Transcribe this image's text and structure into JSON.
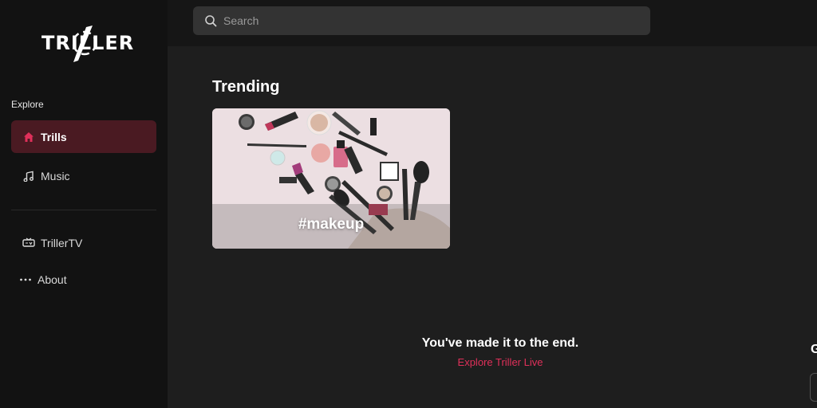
{
  "app": {
    "logo_text": "TRILLER"
  },
  "sidebar": {
    "section_label": "Explore",
    "items": [
      {
        "label": "Trills",
        "icon": "home-icon",
        "active": true
      },
      {
        "label": "Music",
        "icon": "music-note-icon",
        "active": false
      }
    ],
    "secondary_items": [
      {
        "label": "TrillerTV",
        "icon": "tv-icon"
      },
      {
        "label": "About",
        "icon": "more-dots-icon"
      }
    ]
  },
  "topbar": {
    "search_placeholder": "Search"
  },
  "main": {
    "trending_title": "Trending",
    "trending_cards": [
      {
        "label": "#makeup"
      }
    ],
    "end_message": "You've made it to the end.",
    "end_link": "Explore Triller Live",
    "right_edge_fragment": "G"
  },
  "colors": {
    "accent": "#e0305a",
    "active_nav_bg": "#4a1a22",
    "sidebar_bg": "#121212",
    "main_bg": "#1e1e1e",
    "search_bg": "#333333"
  }
}
